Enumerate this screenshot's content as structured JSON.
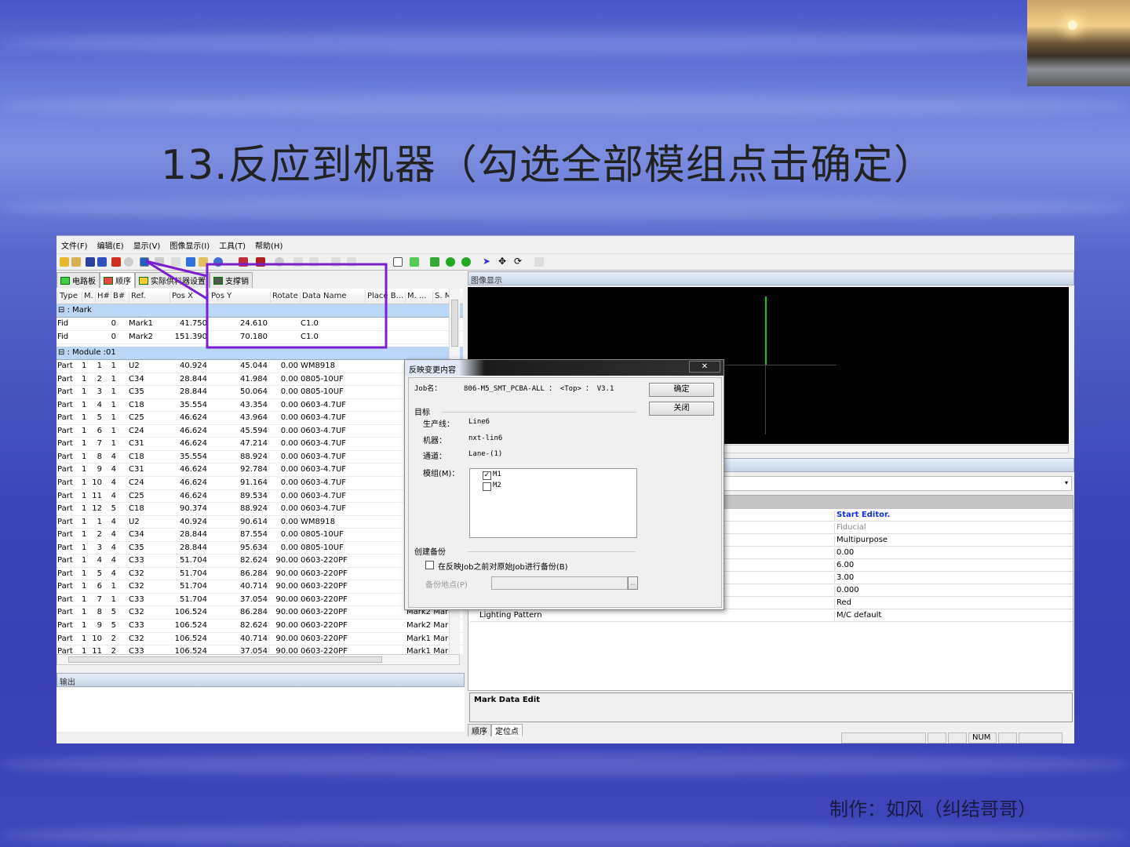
{
  "slide": {
    "title": "13.反应到机器（勾选全部模组点击确定）",
    "credit": "制作：如风（纠结哥哥）"
  },
  "menu": [
    "文件(F)",
    "编辑(E)",
    "显示(V)",
    "图像显示(I)",
    "工具(T)",
    "帮助(H)"
  ],
  "tabs": [
    "电路板",
    "顺序",
    "实际供料器设置",
    "支撑销"
  ],
  "columns": [
    "Type",
    "M.",
    "H#",
    "B#",
    "Ref.",
    "Pos X",
    "Pos Y",
    "Rotate",
    "Data Name",
    "Place B...",
    "M. ...",
    "S. M"
  ],
  "groups": {
    "mark": ": Mark",
    "module": ": Module :01"
  },
  "mark_rows": [
    [
      "Fid",
      "",
      "",
      "0",
      "Mark1",
      "41.750",
      "24.610",
      "",
      "C1.0",
      "",
      ""
    ],
    [
      "Fid",
      "",
      "",
      "0",
      "Mark2",
      "151.390",
      "70.180",
      "",
      "C1.0",
      "",
      ""
    ]
  ],
  "part_rows": [
    [
      "Part",
      "1",
      "1",
      "1",
      "U2",
      "40.924",
      "45.044",
      "0.00",
      "WM8918",
      ""
    ],
    [
      "Part",
      "1",
      "2",
      "1",
      "C34",
      "28.844",
      "41.984",
      "0.00",
      "0805-10UF",
      ""
    ],
    [
      "Part",
      "1",
      "3",
      "1",
      "C35",
      "28.844",
      "50.064",
      "0.00",
      "0805-10UF",
      ""
    ],
    [
      "Part",
      "1",
      "4",
      "1",
      "C18",
      "35.554",
      "43.354",
      "0.00",
      "0603-4.7UF",
      ""
    ],
    [
      "Part",
      "1",
      "5",
      "1",
      "C25",
      "46.624",
      "43.964",
      "0.00",
      "0603-4.7UF",
      ""
    ],
    [
      "Part",
      "1",
      "6",
      "1",
      "C24",
      "46.624",
      "45.594",
      "0.00",
      "0603-4.7UF",
      ""
    ],
    [
      "Part",
      "1",
      "7",
      "1",
      "C31",
      "46.624",
      "47.214",
      "0.00",
      "0603-4.7UF",
      ""
    ],
    [
      "Part",
      "1",
      "8",
      "4",
      "C18",
      "35.554",
      "88.924",
      "0.00",
      "0603-4.7UF",
      ""
    ],
    [
      "Part",
      "1",
      "9",
      "4",
      "C31",
      "46.624",
      "92.784",
      "0.00",
      "0603-4.7UF",
      ""
    ],
    [
      "Part",
      "1",
      "10",
      "4",
      "C24",
      "46.624",
      "91.164",
      "0.00",
      "0603-4.7UF",
      ""
    ],
    [
      "Part",
      "1",
      "11",
      "4",
      "C25",
      "46.624",
      "89.534",
      "0.00",
      "0603-4.7UF",
      ""
    ],
    [
      "Part",
      "1",
      "12",
      "5",
      "C18",
      "90.374",
      "88.924",
      "0.00",
      "0603-4.7UF",
      ""
    ],
    [
      "Part",
      "1",
      "1",
      "4",
      "U2",
      "40.924",
      "90.614",
      "0.00",
      "WM8918",
      ""
    ],
    [
      "Part",
      "1",
      "2",
      "4",
      "C34",
      "28.844",
      "87.554",
      "0.00",
      "0805-10UF",
      ""
    ],
    [
      "Part",
      "1",
      "3",
      "4",
      "C35",
      "28.844",
      "95.634",
      "0.00",
      "0805-10UF",
      ""
    ],
    [
      "Part",
      "1",
      "4",
      "4",
      "C33",
      "51.704",
      "82.624",
      "90.00",
      "0603-220PF",
      ""
    ],
    [
      "Part",
      "1",
      "5",
      "4",
      "C32",
      "51.704",
      "86.284",
      "90.00",
      "0603-220PF",
      ""
    ],
    [
      "Part",
      "1",
      "6",
      "1",
      "C32",
      "51.704",
      "40.714",
      "90.00",
      "0603-220PF",
      ""
    ],
    [
      "Part",
      "1",
      "7",
      "1",
      "C33",
      "51.704",
      "37.054",
      "90.00",
      "0603-220PF",
      ""
    ],
    [
      "Part",
      "1",
      "8",
      "5",
      "C32",
      "106.524",
      "86.284",
      "90.00",
      "0603-220PF",
      "Mark2 Mar"
    ],
    [
      "Part",
      "1",
      "9",
      "5",
      "C33",
      "106.524",
      "82.624",
      "90.00",
      "0603-220PF",
      "Mark2 Mar"
    ],
    [
      "Part",
      "1",
      "10",
      "2",
      "C32",
      "106.524",
      "40.714",
      "90.00",
      "0603-220PF",
      "Mark1 Mar"
    ],
    [
      "Part",
      "1",
      "11",
      "2",
      "C33",
      "106.524",
      "37.054",
      "90.00",
      "0603-220PF",
      "Mark1 Mar"
    ]
  ],
  "panels": {
    "image": "图像显示",
    "output": "输出",
    "mark_edit": "Mark Data Edit"
  },
  "properties": {
    "label": "Lighting Pattern",
    "values": [
      "Start Editor.",
      "Fiducial",
      "Multipurpose",
      "0.00",
      "6.00",
      "3.00",
      "0.000",
      "Red",
      "M/C default"
    ]
  },
  "bottom_tabs": [
    "顺序",
    "定位点"
  ],
  "status": {
    "num": "NUM"
  },
  "dialog": {
    "title": "反映变更内容",
    "job_label": "Job名：",
    "job_value": "806-M5_SMT_PCBA-ALL ： <Top> ： V3.1",
    "ok": "确定",
    "close": "关闭",
    "target": "目标",
    "line_label": "生产线：",
    "line_value": "Line6",
    "machine_label": "机器：",
    "machine_value": "nxt-lin6",
    "lane_label": "通道：",
    "lane_value": "Lane-(1)",
    "module_label": "模组(M)：",
    "modules": [
      {
        "name": "M1",
        "checked": true
      },
      {
        "name": "M2",
        "checked": false
      }
    ],
    "backup": "创建备份",
    "backup_check": "在反映Job之前对原始Job进行备份(B)",
    "backup_loc": "备份地点(P)",
    "browse": ".."
  },
  "colors": {
    "annotation": "#7a1fd0",
    "link": "#1030e0"
  }
}
